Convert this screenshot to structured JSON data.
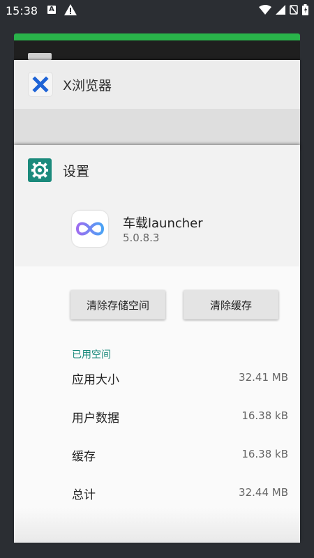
{
  "status_bar": {
    "time": "15:38",
    "a_badge": "A",
    "warning_symbol": "!"
  },
  "recent_cards": {
    "x_browser": {
      "title": "X浏览器",
      "icon": "x-browser-icon"
    },
    "settings": {
      "title": "设置",
      "icon": "gear-icon",
      "app": {
        "name": "车载launcher",
        "version": "5.0.8.3",
        "icon": "infinity-icon"
      },
      "buttons": {
        "clear_storage": "清除存储空间",
        "clear_cache": "清除缓存"
      },
      "section_label": "已用空间",
      "rows": [
        {
          "label": "应用大小",
          "value": "32.41 MB"
        },
        {
          "label": "用户数据",
          "value": "16.38 kB"
        },
        {
          "label": "缓存",
          "value": "16.38 kB"
        },
        {
          "label": "总计",
          "value": "32.44 MB"
        }
      ]
    }
  },
  "colors": {
    "accent": "#1b8a7c",
    "background": "#2b2e33",
    "green_card": "#29b34a"
  }
}
